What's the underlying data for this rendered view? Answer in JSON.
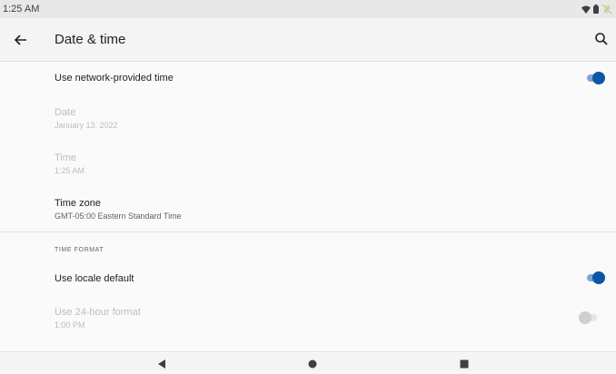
{
  "status_bar": {
    "time": "1:25 AM",
    "icons": [
      "wifi-icon",
      "battery-icon",
      "no-charge-icon"
    ]
  },
  "app_bar": {
    "title": "Date & time",
    "back_icon": "arrow-back-icon",
    "search_icon": "search-icon"
  },
  "settings": {
    "network_time": {
      "label": "Use network-provided time",
      "enabled": true
    },
    "date": {
      "label": "Date",
      "value": "January 13, 2022",
      "disabled": true
    },
    "time": {
      "label": "Time",
      "value": "1:25 AM",
      "disabled": true
    },
    "time_zone": {
      "label": "Time zone",
      "value": "GMT-05:00 Eastern Standard Time"
    }
  },
  "time_format": {
    "header": "TIME FORMAT",
    "locale_default": {
      "label": "Use locale default",
      "enabled": true
    },
    "hour24": {
      "label": "Use 24-hour format",
      "value": "1:00 PM",
      "enabled": false,
      "disabled": true
    }
  },
  "nav_bar": {
    "buttons": [
      "back-triangle-icon",
      "home-circle-icon",
      "recents-square-icon"
    ]
  },
  "colors": {
    "accent": "#0b57a4",
    "accent_track": "#7ea6d8",
    "disabled_text": "#bdbdbd"
  }
}
